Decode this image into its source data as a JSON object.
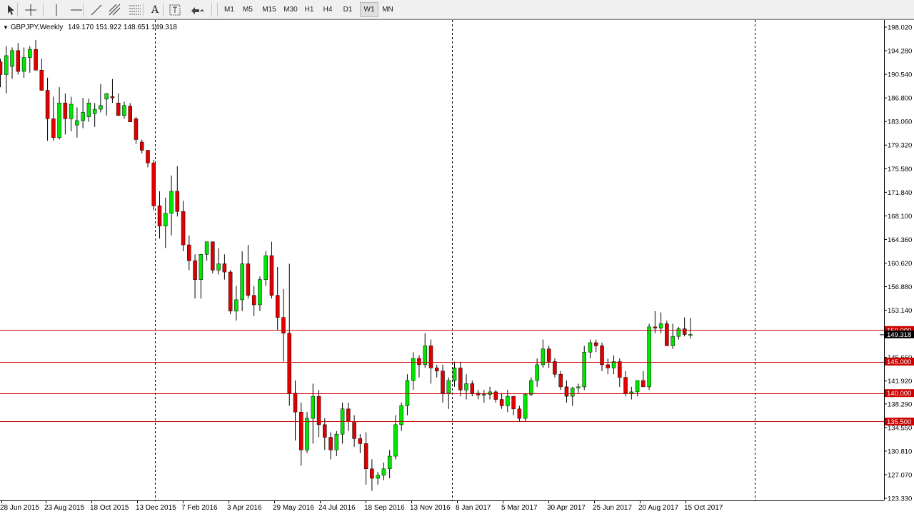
{
  "toolbar": {
    "tools": [
      {
        "name": "cursor-tool-icon"
      },
      {
        "name": "crosshair-tool-icon"
      },
      {
        "name": "vertical-line-tool-icon"
      },
      {
        "name": "horizontal-line-tool-icon"
      },
      {
        "name": "trendline-tool-icon"
      },
      {
        "name": "equidistant-channel-tool-icon"
      },
      {
        "name": "fibonacci-tool-icon"
      },
      {
        "name": "text-tool-icon",
        "label": "A"
      },
      {
        "name": "text-label-tool-icon"
      },
      {
        "name": "arrows-tool-icon"
      }
    ],
    "timeframes": [
      "M1",
      "M5",
      "M15",
      "M30",
      "H1",
      "H4",
      "D1",
      "W1",
      "MN"
    ],
    "active_timeframe": "W1"
  },
  "chart_header": {
    "symbol": "GBPJPY,Weekly",
    "ohlc": "149.170 151.922 148.651 149.318"
  },
  "chart_data": {
    "type": "candlestick",
    "symbol": "GBPJPY",
    "timeframe": "Weekly",
    "ylim": [
      123.33,
      198.02
    ],
    "y_ticks": [
      "198.020",
      "194.280",
      "190.540",
      "186.800",
      "183.060",
      "179.320",
      "175.580",
      "171.840",
      "168.100",
      "164.360",
      "160.620",
      "156.880",
      "153.140",
      "149.318",
      "145.660",
      "141.920",
      "138.290",
      "134.550",
      "130.810",
      "127.070",
      "123.330"
    ],
    "x_ticks": [
      "28 Jun 2015",
      "23 Aug 2015",
      "18 Oct 2015",
      "13 Dec 2015",
      "7 Feb 2016",
      "3 Apr 2016",
      "29 May 2016",
      "24 Jul 2016",
      "18 Sep 2016",
      "13 Nov 2016",
      "8 Jan 2017",
      "5 Mar 2017",
      "30 Apr 2017",
      "25 Jun 2017",
      "20 Aug 2017",
      "15 Oct 2017"
    ],
    "horizontal_levels": [
      {
        "price": 150.0,
        "label": "150.000"
      },
      {
        "price": 145.0,
        "label": "145.000"
      },
      {
        "price": 140.0,
        "label": "140.000"
      },
      {
        "price": 135.5,
        "label": "135.500"
      }
    ],
    "current_price": "149.318",
    "bull_color": "#00e600",
    "bear_color": "#e00000",
    "level_color": "#cc0000",
    "candles": [
      [
        192.5,
        193.0,
        188.5,
        190.5
      ],
      [
        190.5,
        195.0,
        187.5,
        193.5
      ],
      [
        191.8,
        194.8,
        189.8,
        194.3
      ],
      [
        194.3,
        195.5,
        190.5,
        191.0
      ],
      [
        191.0,
        194.8,
        190.0,
        193.2
      ],
      [
        193.2,
        195.0,
        190.8,
        194.5
      ],
      [
        194.5,
        196.0,
        193.0,
        191.2
      ],
      [
        191.2,
        193.0,
        189.5,
        188.0
      ],
      [
        188.0,
        190.0,
        180.0,
        183.5
      ],
      [
        183.5,
        187.0,
        180.0,
        180.5
      ],
      [
        180.5,
        188.5,
        180.2,
        186.0
      ],
      [
        186.0,
        187.5,
        181.0,
        183.5
      ],
      [
        183.5,
        187.0,
        181.5,
        185.8
      ],
      [
        182.5,
        185.3,
        180.5,
        183.2
      ],
      [
        183.2,
        186.8,
        182.0,
        184.5
      ],
      [
        183.8,
        186.7,
        183.0,
        186.0
      ],
      [
        184.3,
        186.0,
        182.2,
        185.0
      ],
      [
        185.0,
        189.0,
        184.5,
        185.6
      ],
      [
        186.6,
        187.5,
        184.0,
        187.5
      ],
      [
        187.0,
        189.8,
        186.0,
        186.8
      ],
      [
        186.0,
        187.5,
        184.8,
        184.0
      ],
      [
        184.0,
        186.2,
        183.5,
        185.6
      ],
      [
        185.5,
        186.0,
        183.8,
        183.0
      ],
      [
        183.5,
        183.8,
        179.5,
        180.2
      ],
      [
        179.8,
        180.2,
        178.0,
        178.5
      ],
      [
        178.5,
        178.5,
        175.8,
        176.5
      ],
      [
        176.5,
        177.0,
        169.0,
        169.7
      ],
      [
        169.7,
        172.0,
        164.5,
        166.5
      ],
      [
        166.5,
        171.0,
        163.0,
        168.5
      ],
      [
        168.5,
        174.5,
        165.0,
        172.0
      ],
      [
        172.0,
        176.0,
        168.0,
        168.8
      ],
      [
        168.8,
        170.5,
        162.5,
        163.5
      ],
      [
        163.5,
        165.0,
        159.5,
        161.0
      ],
      [
        161.0,
        162.0,
        155.0,
        158.0
      ],
      [
        158.0,
        162.0,
        155.0,
        162.0
      ],
      [
        162.0,
        164.0,
        161.0,
        164.0
      ],
      [
        164.0,
        164.0,
        159.0,
        159.5
      ],
      [
        159.5,
        163.0,
        158.8,
        160.5
      ],
      [
        160.5,
        162.0,
        158.0,
        159.2
      ],
      [
        159.2,
        159.5,
        152.5,
        153.0
      ],
      [
        153.0,
        157.0,
        151.5,
        154.8
      ],
      [
        154.8,
        162.5,
        153.0,
        160.5
      ],
      [
        160.5,
        163.5,
        155.0,
        155.5
      ],
      [
        155.5,
        157.0,
        152.2,
        154.0
      ],
      [
        154.0,
        158.5,
        153.0,
        158.0
      ],
      [
        158.0,
        162.5,
        157.0,
        161.8
      ],
      [
        161.8,
        164.0,
        155.0,
        155.5
      ],
      [
        155.5,
        160.0,
        150.0,
        152.0
      ],
      [
        152.0,
        156.5,
        145.0,
        149.5
      ],
      [
        149.5,
        160.5,
        138.0,
        140.0
      ],
      [
        140.0,
        142.0,
        132.5,
        137.0
      ],
      [
        137.0,
        138.5,
        128.5,
        131.0
      ],
      [
        131.0,
        137.0,
        130.5,
        136.0
      ],
      [
        136.0,
        141.5,
        132.0,
        139.5
      ],
      [
        139.5,
        140.5,
        133.0,
        135.0
      ],
      [
        135.0,
        136.0,
        131.0,
        133.0
      ],
      [
        133.0,
        133.8,
        129.5,
        131.0
      ],
      [
        131.0,
        134.0,
        130.0,
        133.5
      ],
      [
        133.5,
        138.5,
        132.0,
        137.5
      ],
      [
        137.5,
        138.5,
        134.0,
        135.5
      ],
      [
        135.5,
        136.5,
        131.5,
        132.8
      ],
      [
        132.8,
        133.5,
        130.5,
        132.0
      ],
      [
        132.0,
        133.8,
        125.5,
        128.0
      ],
      [
        128.0,
        129.5,
        124.5,
        126.5
      ],
      [
        126.5,
        127.5,
        125.5,
        127.0
      ],
      [
        127.0,
        129.0,
        126.2,
        128.0
      ],
      [
        128.0,
        131.0,
        126.5,
        130.0
      ],
      [
        130.0,
        136.5,
        129.5,
        135.0
      ],
      [
        135.0,
        138.5,
        134.0,
        138.0
      ],
      [
        138.0,
        143.0,
        136.5,
        142.0
      ],
      [
        142.0,
        146.5,
        140.5,
        145.5
      ],
      [
        145.5,
        146.0,
        142.5,
        144.5
      ],
      [
        144.5,
        149.5,
        144.0,
        147.5
      ],
      [
        147.5,
        148.5,
        141.5,
        144.0
      ],
      [
        144.0,
        144.5,
        142.5,
        143.5
      ],
      [
        143.5,
        144.5,
        138.5,
        140.0
      ],
      [
        140.0,
        142.5,
        137.5,
        142.0
      ],
      [
        142.0,
        145.0,
        141.0,
        144.0
      ],
      [
        144.0,
        145.0,
        139.5,
        140.5
      ],
      [
        140.5,
        143.0,
        139.0,
        141.5
      ],
      [
        141.5,
        142.0,
        139.5,
        140.0
      ],
      [
        140.0,
        140.5,
        139.0,
        139.7
      ],
      [
        139.7,
        140.5,
        138.5,
        139.8
      ],
      [
        139.8,
        141.0,
        139.0,
        140.2
      ],
      [
        140.2,
        140.5,
        138.5,
        139.0
      ],
      [
        139.0,
        140.0,
        137.5,
        138.0
      ],
      [
        138.0,
        140.5,
        137.0,
        139.5
      ],
      [
        139.5,
        139.5,
        136.5,
        137.5
      ],
      [
        137.5,
        138.0,
        135.5,
        136.0
      ],
      [
        136.0,
        140.0,
        135.5,
        139.8
      ],
      [
        139.8,
        142.5,
        139.5,
        142.0
      ],
      [
        142.0,
        145.5,
        141.0,
        144.5
      ],
      [
        144.5,
        148.5,
        144.0,
        147.0
      ],
      [
        147.0,
        147.5,
        144.0,
        145.0
      ],
      [
        145.0,
        145.5,
        142.5,
        143.0
      ],
      [
        143.0,
        143.5,
        140.5,
        141.0
      ],
      [
        141.0,
        142.0,
        138.5,
        139.5
      ],
      [
        139.5,
        141.0,
        138.0,
        140.8
      ],
      [
        140.8,
        141.5,
        140.0,
        141.0
      ],
      [
        141.0,
        147.5,
        140.5,
        146.5
      ],
      [
        146.5,
        148.5,
        145.5,
        148.0
      ],
      [
        148.0,
        148.5,
        146.5,
        147.5
      ],
      [
        147.5,
        148.0,
        143.5,
        144.5
      ],
      [
        144.5,
        145.5,
        143.0,
        144.0
      ],
      [
        144.0,
        146.0,
        143.0,
        145.0
      ],
      [
        145.0,
        145.5,
        141.0,
        142.5
      ],
      [
        142.5,
        143.5,
        139.5,
        140.0
      ],
      [
        140.0,
        141.0,
        139.0,
        140.2
      ],
      [
        140.2,
        142.0,
        139.5,
        142.0
      ],
      [
        142.0,
        143.5,
        141.5,
        141.0
      ],
      [
        141.0,
        151.0,
        140.5,
        150.5
      ],
      [
        150.5,
        153.0,
        149.5,
        150.3
      ],
      [
        150.3,
        152.8,
        149.5,
        151.0
      ],
      [
        151.0,
        151.5,
        149.5,
        147.5
      ],
      [
        147.5,
        151.0,
        147.0,
        149.0
      ],
      [
        149.0,
        150.5,
        148.5,
        150.2
      ],
      [
        150.2,
        152.0,
        149.0,
        149.3
      ],
      [
        149.17,
        151.922,
        148.651,
        149.318
      ]
    ]
  }
}
